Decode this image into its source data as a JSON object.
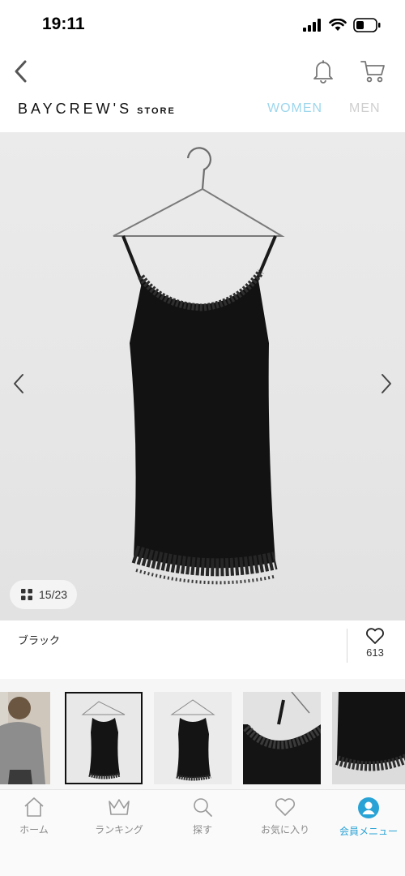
{
  "status_bar": {
    "time": "19:11"
  },
  "header": {
    "brand_main": "BAYCREW'S",
    "brand_sub": "STORE",
    "gender_tabs": [
      {
        "label": "WOMEN",
        "active": true
      },
      {
        "label": "MEN",
        "active": false
      }
    ],
    "accent_color": "#9dd6ec"
  },
  "gallery": {
    "current_index": "15/23",
    "icons": {
      "prev": "chevron-left-icon",
      "next": "chevron-right-icon",
      "grid": "grid-icon"
    }
  },
  "product": {
    "color_name": "ブラック",
    "like_count": "613"
  },
  "thumbnails": [
    {
      "name": "thumb-model",
      "selected": false
    },
    {
      "name": "thumb-front",
      "selected": true
    },
    {
      "name": "thumb-front-alt",
      "selected": false
    },
    {
      "name": "thumb-lace-detail",
      "selected": false
    },
    {
      "name": "thumb-hem-detail",
      "selected": false
    }
  ],
  "tab_bar": {
    "items": [
      {
        "label": "ホーム",
        "icon": "home-icon",
        "active": false
      },
      {
        "label": "ランキング",
        "icon": "crown-icon",
        "active": false
      },
      {
        "label": "探す",
        "icon": "search-icon",
        "active": false
      },
      {
        "label": "お気に入り",
        "icon": "heart-icon",
        "active": false
      },
      {
        "label": "会員メニュー",
        "icon": "user-icon",
        "active": true
      }
    ],
    "active_color": "#29a3d6"
  }
}
